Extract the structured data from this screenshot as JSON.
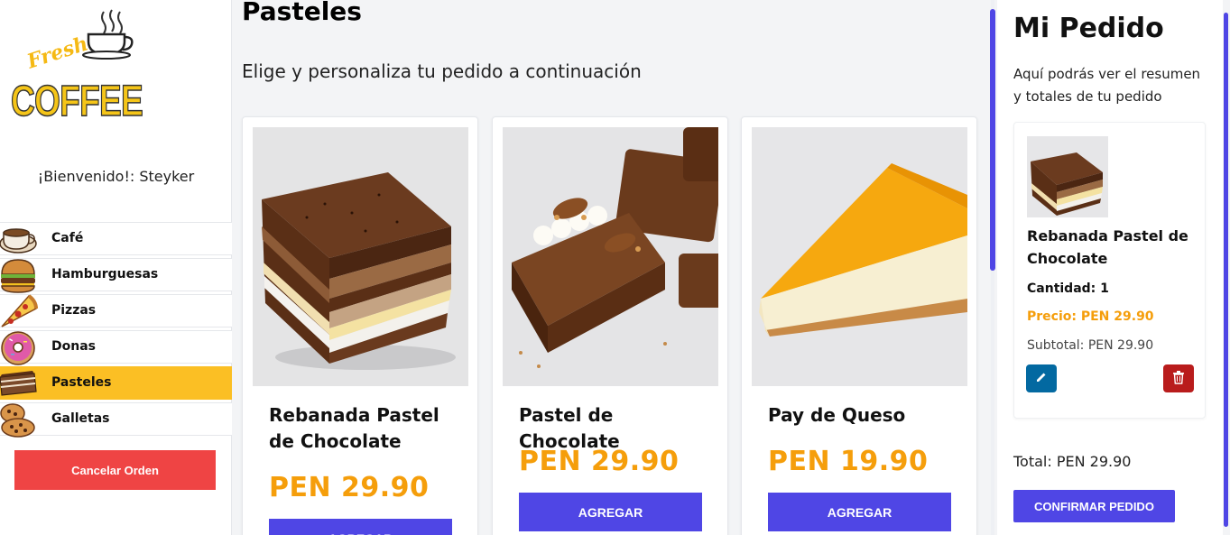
{
  "sidebar": {
    "logo": {
      "top_text": "Fresh",
      "main_text": "COFFEE",
      "icon": "coffee-cup-icon"
    },
    "welcome": "¡Bienvenido!: Steyker",
    "categories": [
      {
        "label": "Café",
        "icon": "coffee-icon",
        "active": false
      },
      {
        "label": "Hamburguesas",
        "icon": "burger-icon",
        "active": false
      },
      {
        "label": "Pizzas",
        "icon": "pizza-icon",
        "active": false
      },
      {
        "label": "Donas",
        "icon": "donut-icon",
        "active": false
      },
      {
        "label": "Pasteles",
        "icon": "cake-icon",
        "active": true
      },
      {
        "label": "Galletas",
        "icon": "cookie-icon",
        "active": false
      }
    ],
    "cancel_label": "Cancelar Orden"
  },
  "main": {
    "title": "Pasteles",
    "subtitle": "Elige y personaliza tu pedido a continuación",
    "products": [
      {
        "name": "Rebanada Pastel de Chocolate",
        "price": "PEN 29.90",
        "button": "AGREGAR",
        "image": "chocolate-cake-slice-image"
      },
      {
        "name": "Pastel de Chocolate",
        "price": "PEN 29.90",
        "button": "AGREGAR",
        "image": "chocolate-bars-image"
      },
      {
        "name": "Pay de Queso",
        "price": "PEN 19.90",
        "button": "AGREGAR",
        "image": "cheesecake-image"
      }
    ]
  },
  "order": {
    "title": "Mi Pedido",
    "description": "Aquí podrás ver el resumen y totales de tu pedido",
    "items": [
      {
        "name": "Rebanada Pastel de Chocolate",
        "quantity": "Cantidad: 1",
        "price": "Precio: PEN 29.90",
        "subtotal": "Subtotal: PEN 29.90"
      }
    ],
    "total": "Total: PEN 29.90",
    "confirm_label": "CONFIRMAR PEDIDO"
  },
  "colors": {
    "accent": "#4f46e5",
    "active_category": "#fbbf24",
    "price": "#f59e0b",
    "cancel": "#ef4444",
    "edit": "#0369a1",
    "delete": "#b91c1c"
  }
}
